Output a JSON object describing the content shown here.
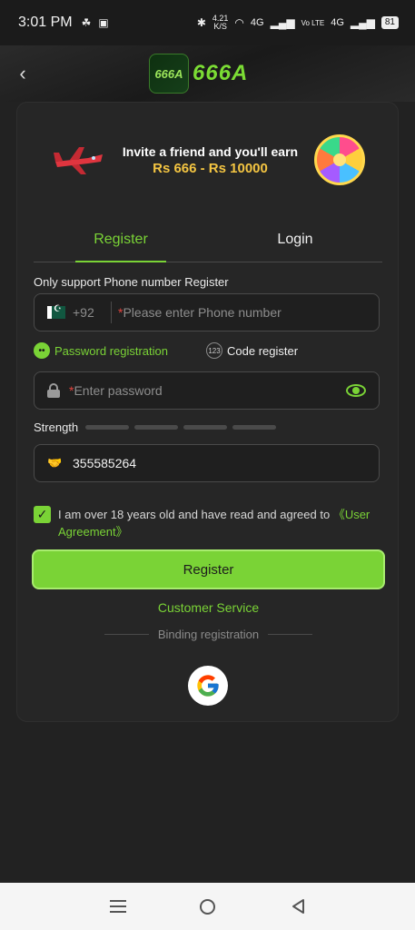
{
  "status_bar": {
    "time": "3:01 PM",
    "speed_value": "4.21",
    "speed_unit": "K/S",
    "network_1": "4G",
    "network_2": "Vo LTE",
    "network_3": "4G",
    "battery": "81"
  },
  "header": {
    "logo_small": "666A",
    "logo_text": "666A"
  },
  "banner": {
    "line1": "Invite a friend and you'll earn",
    "line2": "Rs 666 - Rs 10000"
  },
  "tabs": [
    {
      "label": "Register",
      "active": true
    },
    {
      "label": "Login",
      "active": false
    }
  ],
  "support_label": "Only support Phone number Register",
  "phone": {
    "country_code": "+92",
    "required_mark": "*",
    "placeholder": "Please enter Phone number"
  },
  "modes": {
    "password_label": "Password registration",
    "code_label": "Code register",
    "code_badge": "123",
    "active": "password"
  },
  "password": {
    "required_mark": "*",
    "placeholder": "Enter password"
  },
  "strength": {
    "label": "Strength",
    "level": 0
  },
  "invite_code": {
    "value": "355585264"
  },
  "agreement": {
    "checked": true,
    "text": "I am over 18 years old and have read and agreed to ",
    "link": "《User Agreement》"
  },
  "register_button": "Register",
  "customer_service": "Customer Service",
  "binding_label": "Binding registration",
  "colors": {
    "accent": "#7ad336",
    "background": "#222222",
    "card": "#262626",
    "required": "#e0443e"
  }
}
